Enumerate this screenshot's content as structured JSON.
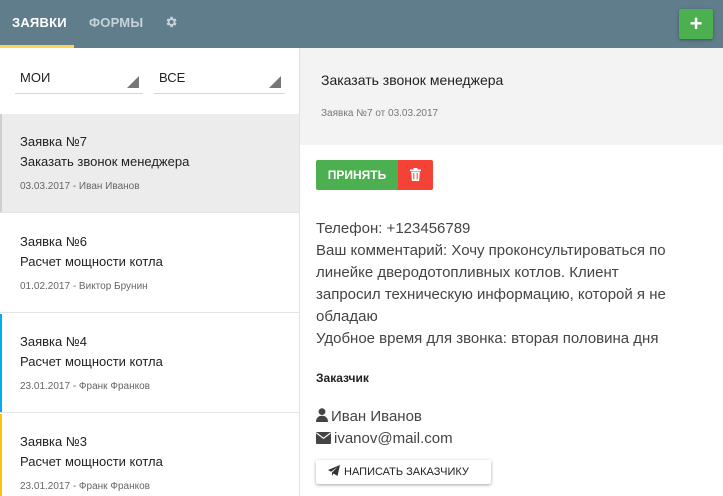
{
  "nav": {
    "tabs": [
      {
        "label": "Заявки",
        "active": true
      },
      {
        "label": "Формы",
        "active": false
      }
    ],
    "settings_icon": "gear-icon",
    "add_label": "+",
    "accent_color": "#ffd54f",
    "bar_color": "#607d8b"
  },
  "filters": {
    "owner": "мои",
    "status": "все"
  },
  "tickets": [
    {
      "title": "Заявка №7",
      "subject": "Заказать звонок менеджера",
      "meta": "03.03.2017 - Иван Иванов",
      "selected": true,
      "stripe": ""
    },
    {
      "title": "Заявка №6",
      "subject": "Расчет мощности котла",
      "meta": "01.02.2017 - Виктор Брунин",
      "selected": false,
      "stripe": ""
    },
    {
      "title": "Заявка №4",
      "subject": "Расчет мощности котла",
      "meta": "23.01.2017 - Франк Франков",
      "selected": false,
      "stripe": "#03a9f4"
    },
    {
      "title": "Заявка №3",
      "subject": "Расчет мощности котла",
      "meta": "23.01.2017 - Франк Франков",
      "selected": false,
      "stripe": "#ffc107"
    }
  ],
  "detail": {
    "title": "Заказать звонок менеджера",
    "meta": "Заявка №7 от 03.03.2017",
    "accept_label": "Принять",
    "delete_icon": "trash-icon",
    "body_lines": [
      "Телефон: +123456789",
      "Ваш комментарий: Хочу проконсультироваться по",
      "линейке дверодотопливных котлов. Клиент",
      "запросил техническую информацию, которой я не",
      "обладаю",
      "Удобное время для звонка: вторая половина дня"
    ],
    "customer_heading": "Заказчик",
    "customer_name": "Иван Иванов",
    "customer_email": "ivanov@mail.com",
    "write_label": "Написать заказчику",
    "accept_color": "#4caf50",
    "delete_color": "#f44336"
  }
}
